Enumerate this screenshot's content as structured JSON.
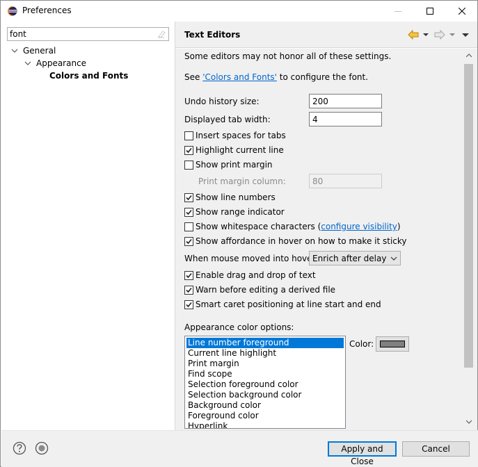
{
  "window": {
    "title": "Preferences"
  },
  "filter": {
    "value": "font"
  },
  "tree": {
    "general": "General",
    "appearance": "Appearance",
    "colors_fonts": "Colors and Fonts"
  },
  "page": {
    "title": "Text Editors",
    "note": "Some editors may not honor all of these settings.",
    "see_prefix": "See ",
    "see_link": "'Colors and Fonts'",
    "see_suffix": " to configure the font.",
    "undo_label": "Undo history size:",
    "undo_value": "200",
    "tab_label": "Displayed tab width:",
    "tab_value": "4",
    "insert_spaces": "Insert spaces for tabs",
    "highlight_line": "Highlight current line",
    "show_margin": "Show print margin",
    "margin_col_label": "Print margin column:",
    "margin_col_value": "80",
    "show_line_numbers": "Show line numbers",
    "show_range": "Show range indicator",
    "show_whitespace": "Show whitespace characters (",
    "configure_visibility": "configure visibility",
    "close_paren": ")",
    "show_affordance": "Show affordance in hover on how to make it sticky",
    "hover_label": "When mouse moved into hover:",
    "hover_value": "Enrich after delay",
    "drag_drop": "Enable drag and drop of text",
    "warn_derived": "Warn before editing a derived file",
    "smart_caret": "Smart caret positioning at line start and end",
    "appearance_colors_label": "Appearance color options:",
    "color_label": "Color:",
    "color_options": [
      "Line number foreground",
      "Current line highlight",
      "Print margin",
      "Find scope",
      "Selection foreground color",
      "Selection background color",
      "Background color",
      "Foreground color",
      "Hyperlink"
    ],
    "selected_color_value": "#808080"
  },
  "checkboxes": {
    "insert_spaces": false,
    "highlight_line": true,
    "show_margin": false,
    "show_line_numbers": true,
    "show_range": true,
    "show_whitespace": false,
    "show_affordance": true,
    "drag_drop": true,
    "warn_derived": true,
    "smart_caret": true
  },
  "buttons": {
    "apply_close": "Apply and Close",
    "cancel": "Cancel"
  },
  "colors": {
    "accent": "#0078d7",
    "link": "#0066cc"
  }
}
